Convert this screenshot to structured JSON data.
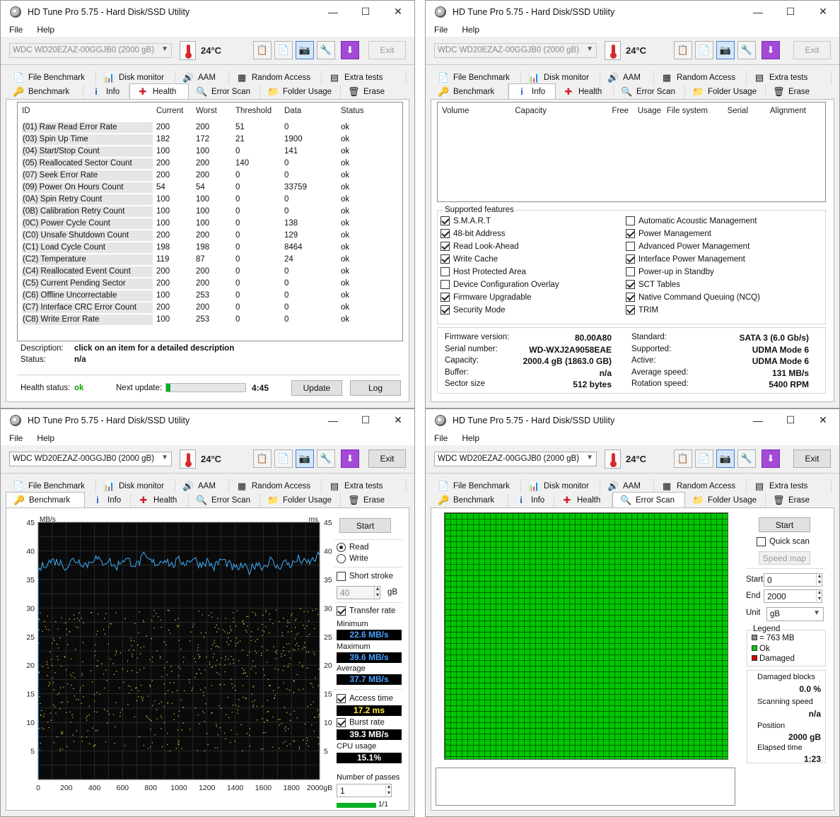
{
  "window_title": "HD Tune Pro 5.75 - Hard Disk/SSD Utility",
  "menu": {
    "file": "File",
    "help": "Help"
  },
  "drive": "WDC WD20EZAZ-00GGJB0 (2000 gB)",
  "temperature": "24°C",
  "exit_label": "Exit",
  "tabs": {
    "file_benchmark": "File Benchmark",
    "disk_monitor": "Disk monitor",
    "aam": "AAM",
    "random_access": "Random Access",
    "extra_tests": "Extra tests",
    "benchmark": "Benchmark",
    "info": "Info",
    "health": "Health",
    "error_scan": "Error Scan",
    "folder_usage": "Folder Usage",
    "erase": "Erase"
  },
  "health": {
    "columns": [
      "ID",
      "Current",
      "Worst",
      "Threshold",
      "Data",
      "Status"
    ],
    "rows": [
      [
        "(01) Raw Read Error Rate",
        "200",
        "200",
        "51",
        "0",
        "ok"
      ],
      [
        "(03) Spin Up Time",
        "182",
        "172",
        "21",
        "1900",
        "ok"
      ],
      [
        "(04) Start/Stop Count",
        "100",
        "100",
        "0",
        "141",
        "ok"
      ],
      [
        "(05) Reallocated Sector Count",
        "200",
        "200",
        "140",
        "0",
        "ok"
      ],
      [
        "(07) Seek Error Rate",
        "200",
        "200",
        "0",
        "0",
        "ok"
      ],
      [
        "(09) Power On Hours Count",
        "54",
        "54",
        "0",
        "33759",
        "ok"
      ],
      [
        "(0A) Spin Retry Count",
        "100",
        "100",
        "0",
        "0",
        "ok"
      ],
      [
        "(0B) Calibration Retry Count",
        "100",
        "100",
        "0",
        "0",
        "ok"
      ],
      [
        "(0C) Power Cycle Count",
        "100",
        "100",
        "0",
        "138",
        "ok"
      ],
      [
        "(C0) Unsafe Shutdown Count",
        "200",
        "200",
        "0",
        "129",
        "ok"
      ],
      [
        "(C1) Load Cycle Count",
        "198",
        "198",
        "0",
        "8464",
        "ok"
      ],
      [
        "(C2) Temperature",
        "119",
        "87",
        "0",
        "24",
        "ok"
      ],
      [
        "(C4) Reallocated Event Count",
        "200",
        "200",
        "0",
        "0",
        "ok"
      ],
      [
        "(C5) Current Pending Sector",
        "200",
        "200",
        "0",
        "0",
        "ok"
      ],
      [
        "(C6) Offline Uncorrectable",
        "100",
        "253",
        "0",
        "0",
        "ok"
      ],
      [
        "(C7) Interface CRC Error Count",
        "200",
        "200",
        "0",
        "0",
        "ok"
      ],
      [
        "(C8) Write Error Rate",
        "100",
        "253",
        "0",
        "0",
        "ok"
      ]
    ],
    "description_label": "Description:",
    "description_value": "click on an item for a detailed description",
    "status_label": "Status:",
    "status_value": "n/a",
    "health_status_label": "Health status:",
    "health_status_value": "ok",
    "next_update_label": "Next update:",
    "next_update_value": "4:45",
    "next_update_progress": 0.05,
    "update_button": "Update",
    "log_button": "Log"
  },
  "info": {
    "columns": [
      "Volume",
      "Capacity",
      "Free",
      "Usage",
      "File system",
      "Serial",
      "Alignment"
    ],
    "supported_features_label": "Supported features",
    "features_left": [
      {
        "label": "S.M.A.R.T",
        "checked": true
      },
      {
        "label": "48-bit Address",
        "checked": true
      },
      {
        "label": "Read Look-Ahead",
        "checked": true
      },
      {
        "label": "Write Cache",
        "checked": true
      },
      {
        "label": "Host Protected Area",
        "checked": false
      },
      {
        "label": "Device Configuration Overlay",
        "checked": false
      },
      {
        "label": "Firmware Upgradable",
        "checked": true
      },
      {
        "label": "Security Mode",
        "checked": true
      }
    ],
    "features_right": [
      {
        "label": "Automatic Acoustic Management",
        "checked": false
      },
      {
        "label": "Power Management",
        "checked": true
      },
      {
        "label": "Advanced Power Management",
        "checked": false
      },
      {
        "label": "Interface Power Management",
        "checked": true
      },
      {
        "label": "Power-up in Standby",
        "checked": false
      },
      {
        "label": "SCT Tables",
        "checked": true
      },
      {
        "label": "Native Command Queuing (NCQ)",
        "checked": true
      },
      {
        "label": "TRIM",
        "checked": true
      }
    ],
    "details_left": [
      {
        "label": "Firmware version:",
        "value": "80.00A80"
      },
      {
        "label": "Serial number:",
        "value": "WD-WXJ2A9058EAE"
      },
      {
        "label": "Capacity:",
        "value": "2000.4 gB (1863.0 GB)"
      },
      {
        "label": "Buffer:",
        "value": "n/a"
      },
      {
        "label": "Sector size",
        "value": "512 bytes"
      }
    ],
    "details_right": [
      {
        "label": "Standard:",
        "value": "SATA 3 (6.0 Gb/s)"
      },
      {
        "label": "Supported:",
        "value": "UDMA Mode 6"
      },
      {
        "label": "Active:",
        "value": "UDMA Mode 6"
      },
      {
        "label": "Average speed:",
        "value": "131 MB/s"
      },
      {
        "label": "Rotation speed:",
        "value": "5400 RPM"
      }
    ]
  },
  "benchmark": {
    "start_button": "Start",
    "read_label": "Read",
    "write_label": "Write",
    "short_stroke_label": "Short stroke",
    "short_stroke_value": "40",
    "short_stroke_unit": "gB",
    "transfer_rate_label": "Transfer rate",
    "minimum_label": "Minimum",
    "minimum_value": "22.6 MB/s",
    "maximum_label": "Maximum",
    "maximum_value": "39.6 MB/s",
    "average_label": "Average",
    "average_value": "37.7 MB/s",
    "access_time_label": "Access time",
    "access_time_value": "17.2 ms",
    "burst_rate_label": "Burst rate",
    "burst_rate_value": "39.3 MB/s",
    "cpu_usage_label": "CPU usage",
    "cpu_usage_value": "15.1%",
    "passes_label": "Number of passes",
    "passes_value": "1",
    "passes_progress": "1/1",
    "passes_fraction": 1.0
  },
  "chart_data": {
    "type": "line",
    "left_unit": "MB/s",
    "right_unit": "ms",
    "y_ticks": [
      "5",
      "10",
      "15",
      "20",
      "25",
      "30",
      "35",
      "40",
      "45"
    ],
    "x_ticks": [
      "0",
      "200",
      "400",
      "600",
      "800",
      "1000",
      "1200",
      "1400",
      "1600",
      "1800",
      "2000gB"
    ],
    "xlim": [
      0,
      2000
    ],
    "ylim": [
      0,
      45
    ],
    "grid": true,
    "series": [
      {
        "values_x": [
          0,
          50,
          100,
          150,
          200,
          250,
          300,
          350,
          400,
          450,
          500,
          550,
          600,
          650,
          700,
          750,
          800,
          850,
          900,
          950,
          1000,
          1050,
          1100,
          1150,
          1200,
          1250,
          1300,
          1350,
          1400,
          1450,
          1500,
          1550,
          1600,
          1650,
          1700,
          1750,
          1800,
          1850,
          1900,
          1950,
          2000
        ],
        "values_y": [
          36.5,
          37.8,
          38.3,
          38.0,
          37.2,
          38.5,
          38.1,
          37.6,
          38.9,
          37.9,
          38.4,
          37.0,
          38.6,
          38.2,
          37.5,
          39.0,
          38.1,
          37.8,
          38.7,
          37.4,
          38.3,
          37.9,
          38.8,
          37.6,
          38.2,
          37.1,
          38.5,
          37.7,
          36.8,
          37.3,
          36.5,
          37.9,
          37.2,
          38.4,
          37.0,
          38.1,
          37.5,
          38.6,
          37.8,
          38.3,
          39.2
        ]
      }
    ],
    "access_points": {
      "x_range": [
        0,
        2000
      ],
      "y_range": [
        5,
        30
      ]
    }
  },
  "error_scan": {
    "start_button": "Start",
    "quick_scan_label": "Quick scan",
    "speed_map_button": "Speed map",
    "start_label": "Start",
    "start_value": "0",
    "end_label": "End",
    "end_value": "2000",
    "unit_label": "Unit",
    "unit_value": "gB",
    "legend_label": "Legend",
    "legend_block": "= 763 MB",
    "legend_ok": "Ok",
    "legend_damaged": "Damaged",
    "damaged_blocks_label": "Damaged blocks",
    "damaged_blocks_value": "0.0 %",
    "scanning_speed_label": "Scanning speed",
    "scanning_speed_value": "n/a",
    "position_label": "Position",
    "position_value": "2000 gB",
    "elapsed_label": "Elapsed time",
    "elapsed_value": "1:23"
  },
  "colors": {
    "ok_green": "#00c800",
    "grid_line": "#006400",
    "damaged_red": "#d00000",
    "chart_line": "#3aa0e6",
    "access_dot": "#e8e84a"
  }
}
